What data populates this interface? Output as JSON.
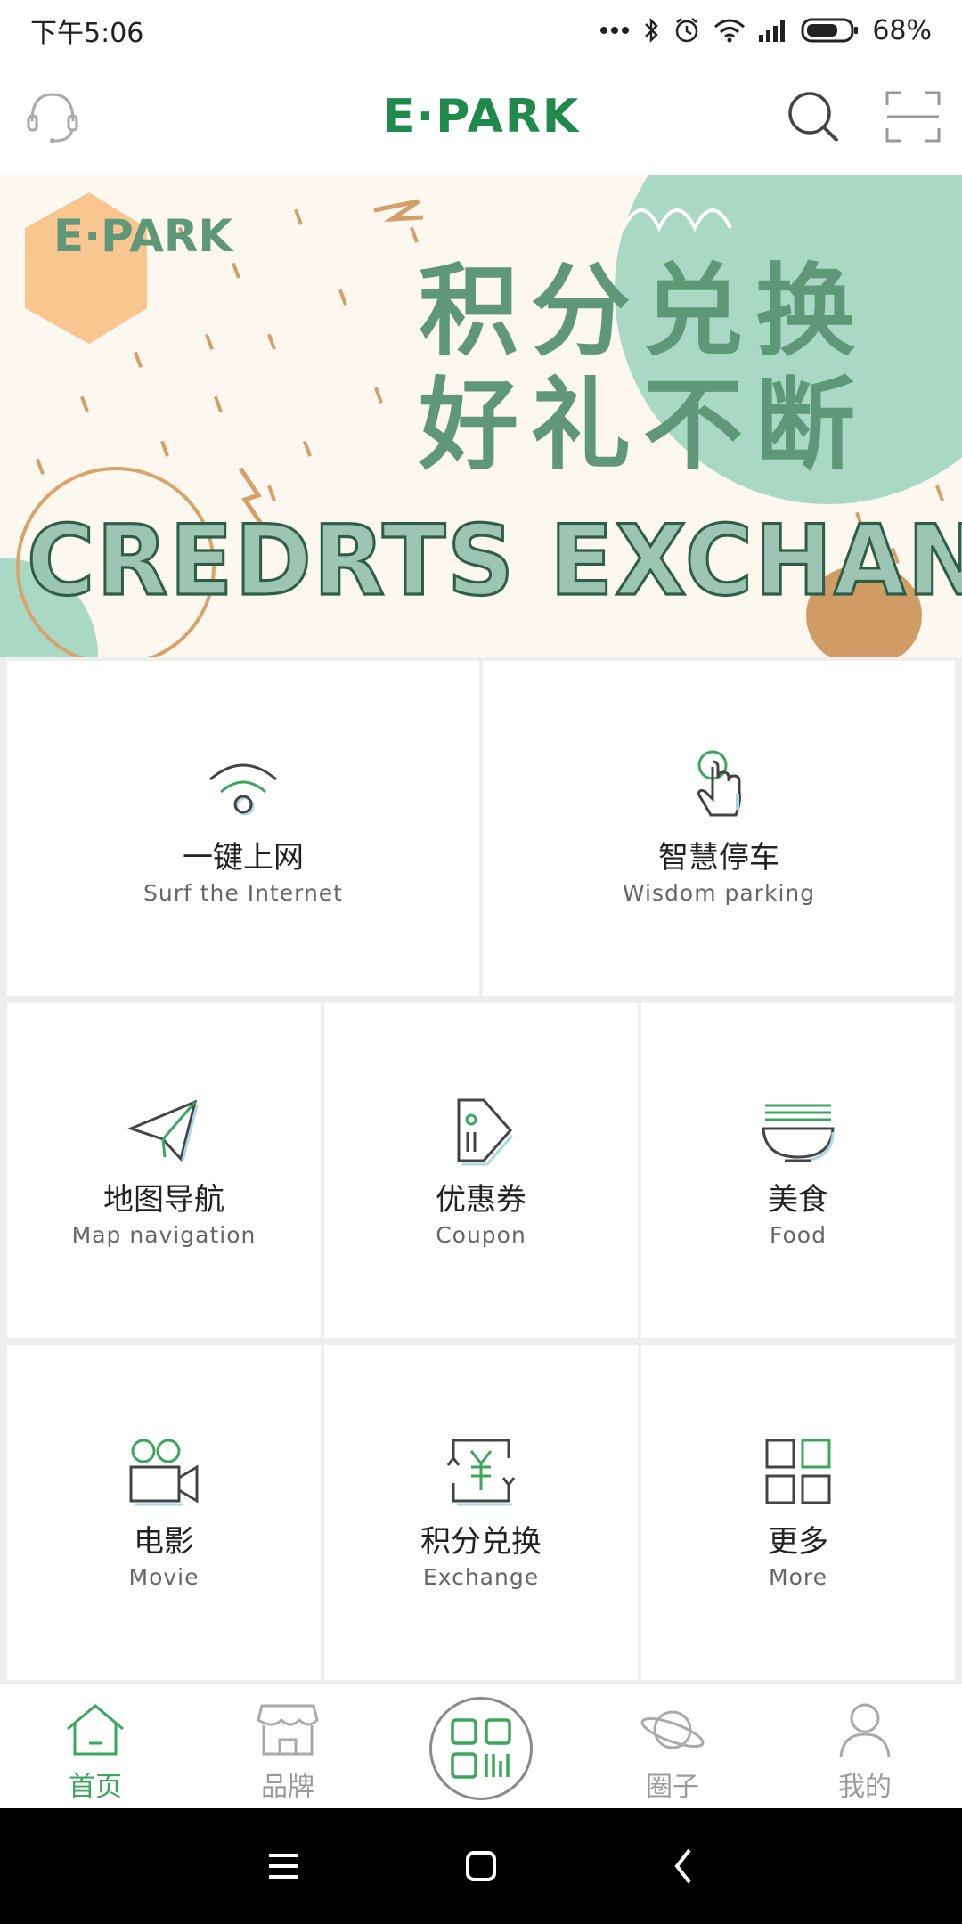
{
  "status_bar": {
    "time": "下午5:06",
    "battery": "68%"
  },
  "header": {
    "logo_text": "E·PARK"
  },
  "banner": {
    "logo_text": "E·PARK",
    "title_line1": "积分兑换",
    "title_line2": "好礼不断",
    "subtitle": "CREDRTS EXCHANGE"
  },
  "grid": {
    "items": [
      {
        "cn": "一键上网",
        "en": "Surf the Internet",
        "icon": "wifi-icon"
      },
      {
        "cn": "智慧停车",
        "en": "Wisdom parking",
        "icon": "touch-icon"
      },
      {
        "cn": "地图导航",
        "en": "Map navigation",
        "icon": "paper-plane-icon"
      },
      {
        "cn": "优惠券",
        "en": "Coupon",
        "icon": "tag-icon"
      },
      {
        "cn": "美食",
        "en": "Food",
        "icon": "noodle-bowl-icon"
      },
      {
        "cn": "电影",
        "en": "Movie",
        "icon": "video-camera-icon"
      },
      {
        "cn": "积分兑换",
        "en": "Exchange",
        "icon": "yuan-exchange-icon"
      },
      {
        "cn": "更多",
        "en": "More",
        "icon": "grid-more-icon"
      }
    ]
  },
  "bottom_nav": {
    "items": [
      {
        "label": "首页",
        "icon": "home-icon",
        "active": true
      },
      {
        "label": "品牌",
        "icon": "store-icon",
        "active": false
      },
      {
        "label": "圈子",
        "icon": "planet-icon",
        "active": false
      },
      {
        "label": "我的",
        "icon": "user-icon",
        "active": false
      }
    ],
    "center_icon": "qr-scan-icon"
  },
  "colors": {
    "accent": "#3aa75a",
    "brand": "#1f8a4c",
    "banner_green": "#5f9879",
    "banner_mint": "#a9d8c5"
  }
}
